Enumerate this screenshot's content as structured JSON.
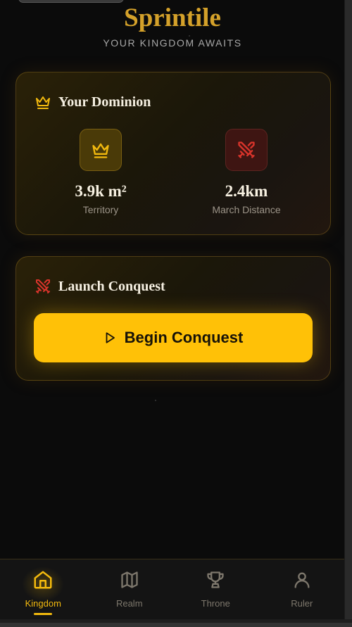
{
  "app": {
    "title": "Sprintile",
    "tagline": "YOUR KINGDOM AWAITS"
  },
  "dominion": {
    "title": "Your Dominion",
    "header_icon": "crown-icon",
    "stats": [
      {
        "value": "3.9k m²",
        "label": "Territory",
        "icon": "crown-icon"
      },
      {
        "value": "2.4km",
        "label": "March Distance",
        "icon": "crossed-swords-icon"
      }
    ]
  },
  "conquest": {
    "title": "Launch Conquest",
    "header_icon": "crossed-swords-icon",
    "button_label": "Begin Conquest",
    "button_icon": "play-icon"
  },
  "nav": {
    "items": [
      {
        "label": "Kingdom",
        "icon": "home-icon",
        "active": true
      },
      {
        "label": "Realm",
        "icon": "map-icon",
        "active": false
      },
      {
        "label": "Throne",
        "icon": "trophy-icon",
        "active": false
      },
      {
        "label": "Ruler",
        "icon": "user-icon",
        "active": false
      }
    ]
  },
  "colors": {
    "accent": "#ffc107",
    "title_gold": "#d4a12a",
    "danger_red": "#d9342b",
    "background": "#0b0b0b"
  }
}
